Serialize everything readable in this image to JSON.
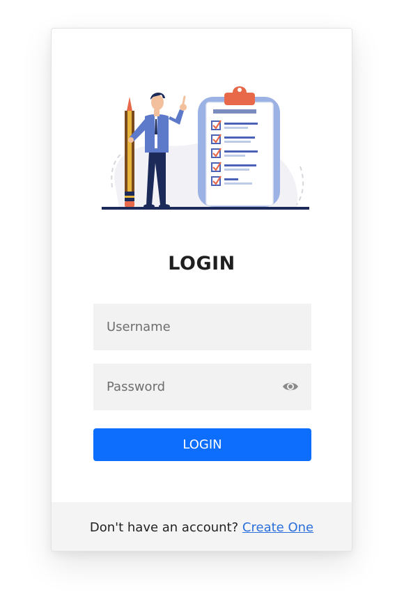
{
  "title": "LOGIN",
  "username": {
    "placeholder": "Username",
    "value": ""
  },
  "password": {
    "placeholder": "Password",
    "value": ""
  },
  "login_button": "LOGIN",
  "footer": {
    "prompt": "Don't have an account?",
    "link": "Create One"
  },
  "icons": {
    "password_toggle": "eye-icon"
  },
  "colors": {
    "accent": "#0d6efd",
    "field_bg": "#f2f2f2",
    "footer_bg": "#f4f4f4",
    "link": "#2a6fdb"
  }
}
